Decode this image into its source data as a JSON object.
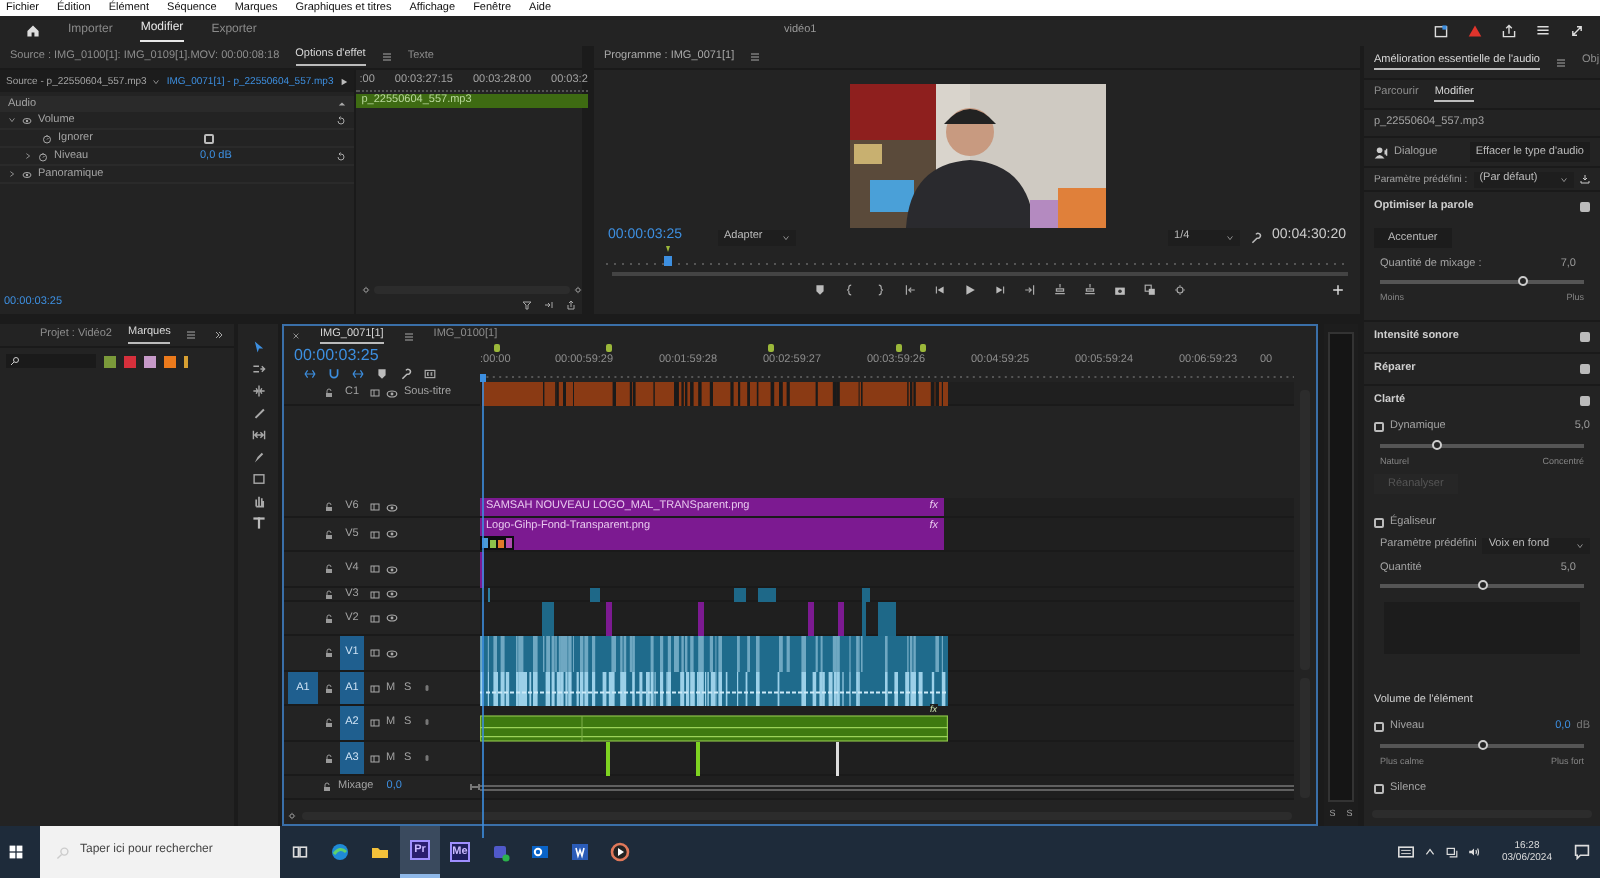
{
  "menu": [
    "Fichier",
    "Édition",
    "Élément",
    "Séquence",
    "Marques",
    "Graphiques et titres",
    "Affichage",
    "Fenêtre",
    "Aide"
  ],
  "workspaces": [
    {
      "label": "Importer",
      "selected": false
    },
    {
      "label": "Modifier",
      "selected": true
    },
    {
      "label": "Exporter",
      "selected": false
    }
  ],
  "document_title": "vidéo1",
  "effect_panel": {
    "tabs": [
      {
        "label": "Source : IMG_0100[1]: IMG_0109[1].MOV: 00:00:08:18",
        "selected": false
      },
      {
        "label": "Options d'effet",
        "selected": true
      },
      {
        "label": "Texte",
        "selected": false
      }
    ],
    "source": "Source - p_22550604_557.mp3",
    "clip": "IMG_0071[1] - p_22550604_557.mp3",
    "section": "Audio",
    "rows": [
      {
        "kind": "effect",
        "label": "Volume",
        "expanded": true
      },
      {
        "kind": "checkbox",
        "label": "Ignorer",
        "checked": false
      },
      {
        "kind": "param",
        "label": "Niveau",
        "value": "0,0 dB",
        "expanded": false
      },
      {
        "kind": "effect",
        "label": "Panoramique",
        "expanded": false
      }
    ],
    "ruler": [
      ":00",
      "00:03:27:15",
      "00:03:28:00",
      "00:03:2"
    ],
    "clip_bar": "p_22550604_557.mp3",
    "timecode": "00:00:03:25"
  },
  "program": {
    "title": "Programme : IMG_0071[1]",
    "timecode": "00:00:03:25",
    "zoom": "Adapter",
    "resolution": "1/4",
    "duration": "00:04:30:20"
  },
  "project_panel": {
    "tabs": [
      {
        "label": "Projet : Vidéo2",
        "selected": false
      },
      {
        "label": "Marques",
        "selected": true
      }
    ],
    "swatches": [
      {
        "color": "#7b9a3a"
      },
      {
        "color": "#d6303c"
      },
      {
        "color": "#c79ac9"
      },
      {
        "color": "#ec7a1c"
      },
      {
        "color": "#d8a032"
      }
    ]
  },
  "timeline": {
    "tabs": [
      {
        "label": "IMG_0071[1]",
        "selected": true
      },
      {
        "label": "IMG_0100[1]",
        "selected": false
      }
    ],
    "timecode": "00:00:03:25",
    "ruler": [
      ":00:00",
      "00:00:59:29",
      "00:01:59:28",
      "00:02:59:27",
      "00:03:59:26",
      "00:04:59:25",
      "00:05:59:24",
      "00:06:59:23",
      "00"
    ],
    "tracks": [
      {
        "kind": "captions",
        "label": "C1",
        "name": "Sous-titre",
        "targeted": false
      },
      {
        "kind": "title",
        "label": "V6",
        "targeted": false,
        "clip": "SAMSAH NOUVEAU LOGO_MAL_TRANSparent.png",
        "effect": "fx"
      },
      {
        "kind": "logo",
        "label": "V5",
        "targeted": false,
        "clip": "Logo-Gihp-Fond-Transparent.png",
        "effect": "fx"
      },
      {
        "kind": "sliver",
        "label": "V4",
        "targeted": false
      },
      {
        "kind": "sparse",
        "label": "V3",
        "targeted": false
      },
      {
        "kind": "mixed",
        "label": "V2",
        "targeted": false
      },
      {
        "kind": "dense",
        "label": "V1",
        "targeted": true
      },
      {
        "kind": "waveform",
        "label": "A1",
        "targeted": true,
        "source": "A1",
        "buttons": [
          "M",
          "S"
        ]
      },
      {
        "kind": "music",
        "label": "A2",
        "targeted": true,
        "effect": "fx",
        "buttons": [
          "M",
          "S"
        ]
      },
      {
        "kind": "blips",
        "label": "A3",
        "targeted": true,
        "buttons": [
          "M",
          "S"
        ]
      }
    ],
    "mix": {
      "label": "Mixage",
      "value": "0,0"
    }
  },
  "meter": {
    "labels": [
      "S",
      "S"
    ]
  },
  "essential_sound": {
    "tabs": [
      {
        "label": "Amélioration essentielle de l'audio",
        "selected": true
      },
      {
        "label": "Obj",
        "selected": false
      }
    ],
    "subtabs": [
      {
        "label": "Parcourir",
        "selected": false
      },
      {
        "label": "Modifier",
        "selected": true
      }
    ],
    "file": "p_22550604_557.mp3",
    "audio_type": "Dialogue",
    "clear_button": "Effacer le type d'audio",
    "preset_label": "Paramètre prédéfini :",
    "preset_value": "(Par défaut)",
    "items": [
      {
        "kind": "section",
        "label": "Optimiser la parole",
        "checked": true
      },
      {
        "kind": "button",
        "label": "Accentuer",
        "disabled": false
      },
      {
        "kind": "value",
        "label": "Quantité de mixage :",
        "value": "7,0"
      },
      {
        "kind": "slider",
        "level": 0.7,
        "min_label": "Moins",
        "max_label": "Plus"
      },
      {
        "kind": "section",
        "label": "Intensité sonore",
        "checked": true
      },
      {
        "kind": "section",
        "label": "Réparer",
        "checked": true
      },
      {
        "kind": "section",
        "label": "Clarté",
        "checked": true
      },
      {
        "kind": "checkbox",
        "label": "Dynamique",
        "checked": false,
        "value": "5,0"
      },
      {
        "kind": "slider",
        "level": 0.27,
        "min_label": "Naturel",
        "max_label": "Concentré"
      },
      {
        "kind": "button",
        "label": "Réanalyser",
        "disabled": true
      },
      {
        "kind": "checkbox",
        "label": "Égaliseur",
        "checked": false
      },
      {
        "kind": "preset",
        "label": "Paramètre prédéfini",
        "value": "Voix en fond"
      },
      {
        "kind": "value",
        "label": "Quantité",
        "value": "5,0"
      },
      {
        "kind": "slider",
        "level": 0.5
      },
      {
        "kind": "graph"
      },
      {
        "kind": "heading",
        "label": "Volume de l'élément"
      },
      {
        "kind": "checkbox",
        "label": "Niveau",
        "checked": false,
        "value": "0,0",
        "unit": "dB"
      },
      {
        "kind": "slider",
        "level": 0.5,
        "min_label": "Plus calme",
        "max_label": "Plus fort"
      },
      {
        "kind": "checkbox",
        "label": "Silence",
        "checked": false
      }
    ]
  },
  "taskbar": {
    "search_placeholder": "Taper ici pour rechercher",
    "apps": [
      {
        "kind": "edge",
        "selected": false
      },
      {
        "kind": "folder",
        "selected": false
      },
      {
        "kind": "badge",
        "label": "Pr",
        "color": "#2a1e6e",
        "selected": true
      },
      {
        "kind": "badge",
        "label": "Me",
        "color": "#1e1e5e",
        "selected": false
      },
      {
        "kind": "teams",
        "selected": false
      },
      {
        "kind": "outlook",
        "selected": false
      },
      {
        "kind": "word",
        "selected": false
      },
      {
        "kind": "player",
        "selected": false
      }
    ],
    "time": "16:28",
    "date": "03/06/2024"
  }
}
